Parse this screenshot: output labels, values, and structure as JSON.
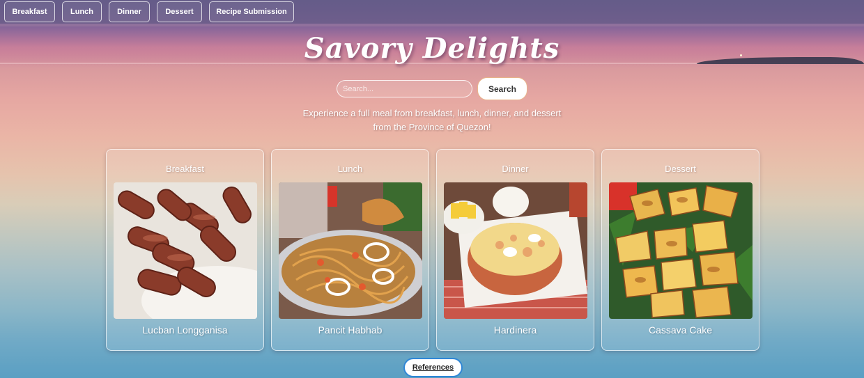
{
  "nav": {
    "items": [
      {
        "label": "Breakfast"
      },
      {
        "label": "Lunch"
      },
      {
        "label": "Dinner"
      },
      {
        "label": "Dessert"
      },
      {
        "label": "Recipe Submission"
      }
    ]
  },
  "header": {
    "title": "Savory Delights"
  },
  "search": {
    "placeholder": "Search...",
    "value": "",
    "button_label": "Search"
  },
  "tagline": {
    "line1": "Experience a full meal from breakfast, lunch, dinner, and dessert",
    "line2": "from the Province of Quezon!"
  },
  "cards": [
    {
      "category": "Breakfast",
      "dish": "Lucban Longganisa",
      "image_icon": "sausage-photo"
    },
    {
      "category": "Lunch",
      "dish": "Pancit Habhab",
      "image_icon": "noodle-photo"
    },
    {
      "category": "Dinner",
      "dish": "Hardinera",
      "image_icon": "meatloaf-photo"
    },
    {
      "category": "Dessert",
      "dish": "Cassava Cake",
      "image_icon": "cake-photo"
    }
  ],
  "footer": {
    "references_label": "References"
  },
  "colors": {
    "nav_bg": "#5f5582",
    "search_border": "#e9b58a",
    "references_border": "#2f86d6"
  }
}
